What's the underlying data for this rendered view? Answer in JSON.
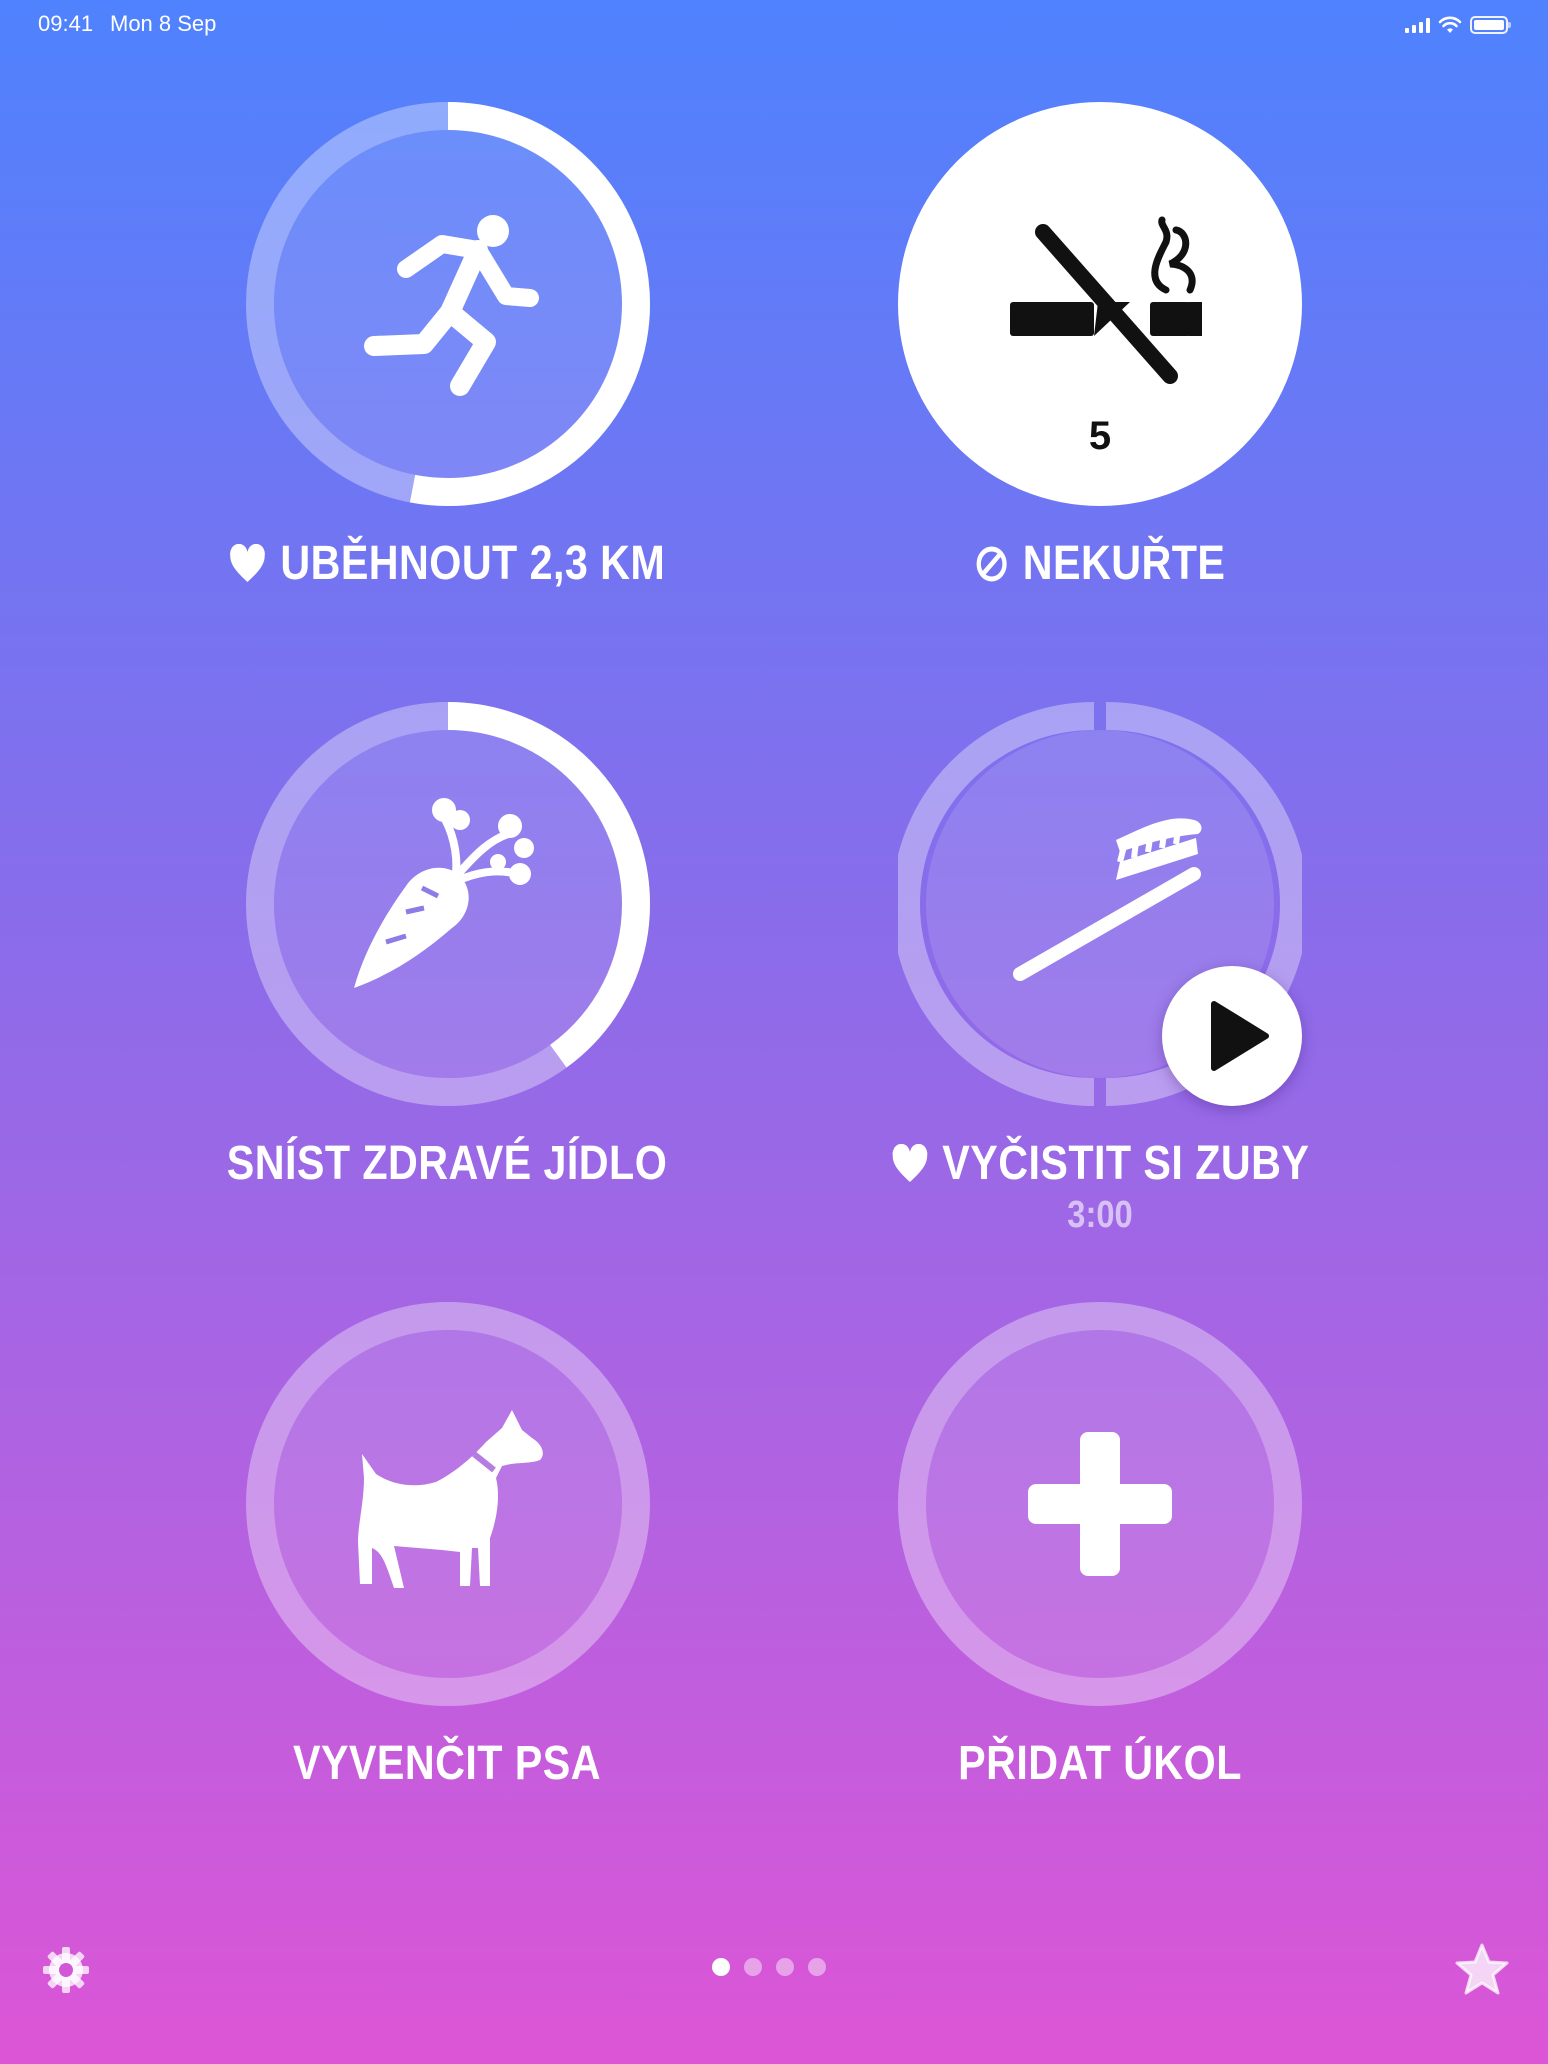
{
  "status_bar": {
    "time": "09:41",
    "date": "Mon 8 Sep",
    "battery_level": 1.0,
    "signal_bars": 4
  },
  "habits": [
    {
      "label": "UBĚHNOUT 2,3 KM",
      "icon": "running-person-icon",
      "favorite": true,
      "progress": 0.53
    },
    {
      "label": "NEKUŘTE",
      "icon": "no-smoking-icon",
      "badge_icon": "prohibited-icon",
      "count": "5",
      "state": "completed"
    },
    {
      "label": "SNÍST ZDRAVÉ JÍDLO",
      "icon": "carrot-icon",
      "favorite": false,
      "progress": 0.4
    },
    {
      "label": "VYČISTIT SI ZUBY",
      "icon": "toothbrush-icon",
      "favorite": true,
      "timer": "3:00",
      "segments": 2,
      "action_icon": "play-icon"
    },
    {
      "label": "VYVENČIT PSA",
      "icon": "dog-icon",
      "favorite": false,
      "progress": 0
    },
    {
      "label": "PŘIDAT ÚKOL",
      "icon": "plus-icon"
    }
  ],
  "toolbar": {
    "settings_icon": "gear-icon",
    "favorites_icon": "star-icon",
    "page_count": 4,
    "current_page": 1
  },
  "colors": {
    "gradient_top": "#4f82fe",
    "gradient_bottom": "#dc55d6",
    "ring_track": "rgba(255,255,255,0.35)",
    "ring_progress": "#ffffff"
  }
}
